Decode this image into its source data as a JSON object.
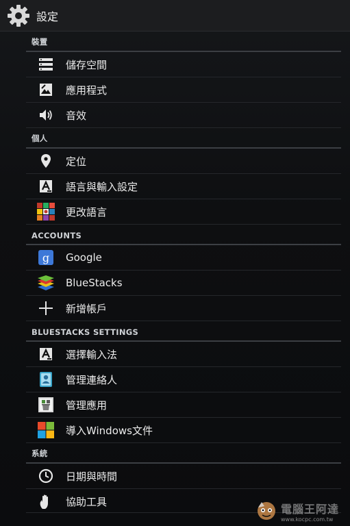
{
  "header": {
    "title": "設定",
    "icon": "gear-icon"
  },
  "sections": [
    {
      "title": "裝置",
      "items": [
        {
          "label": "儲存空間",
          "icon": "storage-icon"
        },
        {
          "label": "應用程式",
          "icon": "apps-icon"
        },
        {
          "label": "音效",
          "icon": "sound-icon"
        }
      ]
    },
    {
      "title": "個人",
      "items": [
        {
          "label": "定位",
          "icon": "location-icon"
        },
        {
          "label": "語言與輸入設定",
          "icon": "language-input-icon"
        },
        {
          "label": "更改語言",
          "icon": "flags-icon"
        }
      ]
    },
    {
      "title": "ACCOUNTS",
      "items": [
        {
          "label": "Google",
          "icon": "google-icon"
        },
        {
          "label": "BlueStacks",
          "icon": "bluestacks-icon"
        },
        {
          "label": "新增帳戶",
          "icon": "add-icon"
        }
      ]
    },
    {
      "title": "BLUESTACKS SETTINGS",
      "items": [
        {
          "label": "選擇輸入法",
          "icon": "keyboard-input-icon"
        },
        {
          "label": "管理連絡人",
          "icon": "contacts-icon"
        },
        {
          "label": "管理應用",
          "icon": "manage-apps-icon"
        },
        {
          "label": "導入Windows文件",
          "icon": "windows-icon"
        }
      ]
    },
    {
      "title": "系統",
      "items": [
        {
          "label": "日期與時間",
          "icon": "clock-icon"
        },
        {
          "label": "協助工具",
          "icon": "hand-icon"
        }
      ]
    }
  ],
  "watermark": {
    "text": "電腦王阿達",
    "url": "www.kocpc.com.tw"
  },
  "colors": {
    "background": "#0b0c0e",
    "actionbar": "#1c1d1f",
    "divider": "#3c3f44",
    "text": "#ececec"
  }
}
